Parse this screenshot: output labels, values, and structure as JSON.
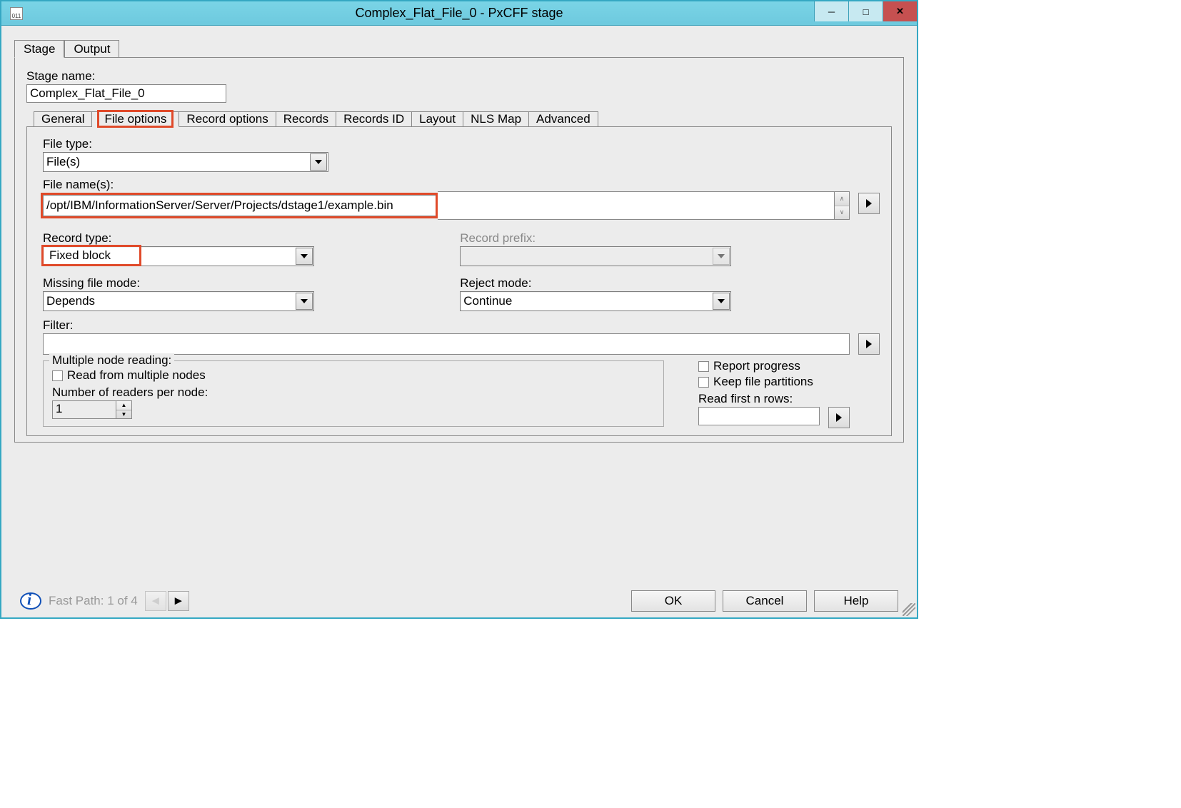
{
  "window": {
    "title": "Complex_Flat_File_0 - PxCFF stage"
  },
  "outerTabs": {
    "stage": "Stage",
    "output": "Output"
  },
  "stageNameLabel": "Stage name:",
  "stageName": "Complex_Flat_File_0",
  "innerTabs": {
    "general": "General",
    "fileOptions": "File options",
    "recordOptions": "Record options",
    "records": "Records",
    "recordsId": "Records ID",
    "layout": "Layout",
    "nlsMap": "NLS Map",
    "advanced": "Advanced"
  },
  "fileTypeLabel": "File type:",
  "fileType": "File(s)",
  "fileNamesLabel": "File name(s):",
  "fileName": "/opt/IBM/InformationServer/Server/Projects/dstage1/example.bin",
  "recordTypeLabel": "Record type:",
  "recordType": "Fixed block",
  "recordPrefixLabel": "Record prefix:",
  "recordPrefix": "",
  "missingFileModeLabel": "Missing file mode:",
  "missingFileMode": "Depends",
  "rejectModeLabel": "Reject mode:",
  "rejectMode": "Continue",
  "filterLabel": "Filter:",
  "filter": "",
  "multipleNodeGroup": "Multiple node reading:",
  "readFromMultipleNodes": "Read from multiple nodes",
  "numReadersLabel": "Number of readers per node:",
  "numReaders": "1",
  "reportProgress": "Report progress",
  "keepFilePartitions": "Keep file partitions",
  "readFirstNRowsLabel": "Read first n rows:",
  "readFirstNRows": "",
  "fastPath": "Fast Path: 1 of 4",
  "buttons": {
    "ok": "OK",
    "cancel": "Cancel",
    "help": "Help"
  }
}
